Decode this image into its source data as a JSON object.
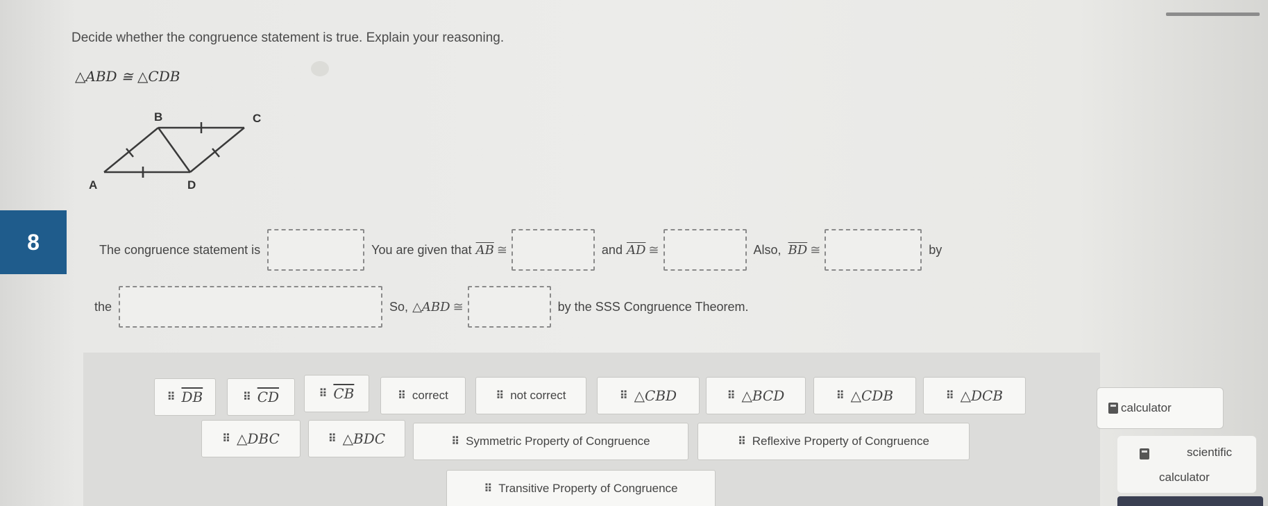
{
  "question": {
    "prompt": "Decide whether the congruence statement is true. Explain your reasoning.",
    "statement": "△ABD ≅ △CDB",
    "number": "8"
  },
  "figure": {
    "labels": {
      "B": "B",
      "C": "C",
      "A": "A",
      "D": "D"
    }
  },
  "sentence": {
    "part1": "The congruence statement is",
    "part2": "You are given that",
    "seg_ab": "AB",
    "part3": "and",
    "seg_ad": "AD",
    "part4": "Also,",
    "seg_bd": "BD",
    "part5": "by",
    "part6": "the",
    "part7": "So,",
    "tri_abd": "△ABD",
    "part8": "by the SSS Congruence Theorem.",
    "cong_symbol": "≅"
  },
  "answer_bank": {
    "items": [
      {
        "label": "DB",
        "kind": "segment"
      },
      {
        "label": "CD",
        "kind": "segment"
      },
      {
        "label": "CB",
        "kind": "segment"
      },
      {
        "label": "correct",
        "kind": "text"
      },
      {
        "label": "not correct",
        "kind": "text"
      },
      {
        "label": "△CBD",
        "kind": "math"
      },
      {
        "label": "△BCD",
        "kind": "math"
      },
      {
        "label": "△CDB",
        "kind": "math"
      },
      {
        "label": "△DCB",
        "kind": "math"
      },
      {
        "label": "△DBC",
        "kind": "math"
      },
      {
        "label": "△BDC",
        "kind": "math"
      },
      {
        "label": "Symmetric Property of Congruence",
        "kind": "text"
      },
      {
        "label": "Reflexive Property of Congruence",
        "kind": "text"
      },
      {
        "label": "Transitive Property of Congruence",
        "kind": "text"
      }
    ],
    "grip_icon": "drag-handle-icon"
  },
  "tools": {
    "calculator_label": "calculator",
    "scientific_line1": "scientific",
    "scientific_line2": "calculator"
  },
  "colors": {
    "question_number_bg": "#1f5c8c",
    "bank_bg": "#dcdcda"
  }
}
